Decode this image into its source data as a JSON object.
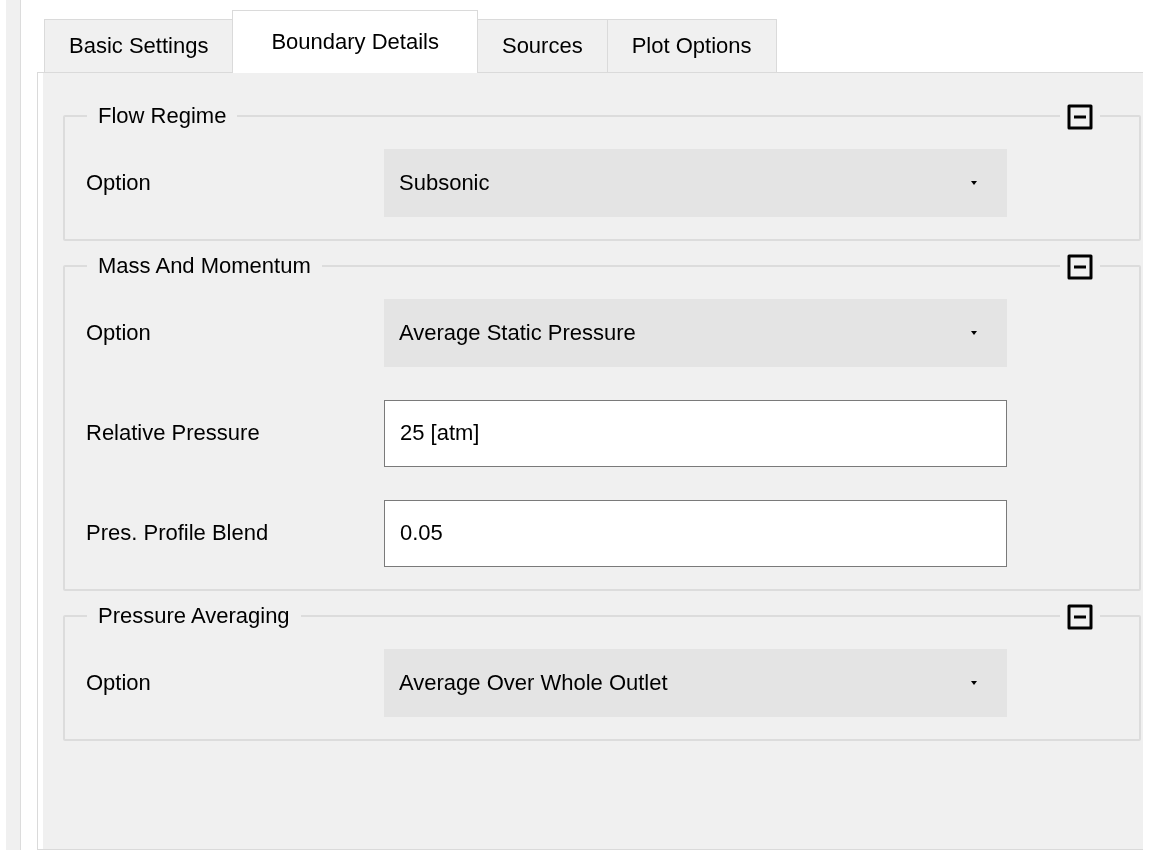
{
  "tabs": [
    {
      "label": "Basic Settings",
      "selected": false
    },
    {
      "label": "Boundary Details",
      "selected": true
    },
    {
      "label": "Sources",
      "selected": false
    },
    {
      "label": "Plot Options",
      "selected": false
    }
  ],
  "groups": [
    {
      "title": "Flow Regime",
      "expanded": true,
      "rows": [
        {
          "label": "Option",
          "kind": "combo",
          "value": "Subsonic"
        }
      ]
    },
    {
      "title": "Mass And Momentum",
      "expanded": true,
      "rows": [
        {
          "label": "Option",
          "kind": "combo",
          "value": "Average Static Pressure"
        },
        {
          "label": "Relative Pressure",
          "kind": "input",
          "value": "25 [atm]"
        },
        {
          "label": "Pres. Profile Blend",
          "kind": "input",
          "value": "0.05"
        }
      ]
    },
    {
      "title": "Pressure Averaging",
      "expanded": true,
      "rows": [
        {
          "label": "Option",
          "kind": "combo",
          "value": "Average Over Whole Outlet"
        }
      ]
    }
  ]
}
